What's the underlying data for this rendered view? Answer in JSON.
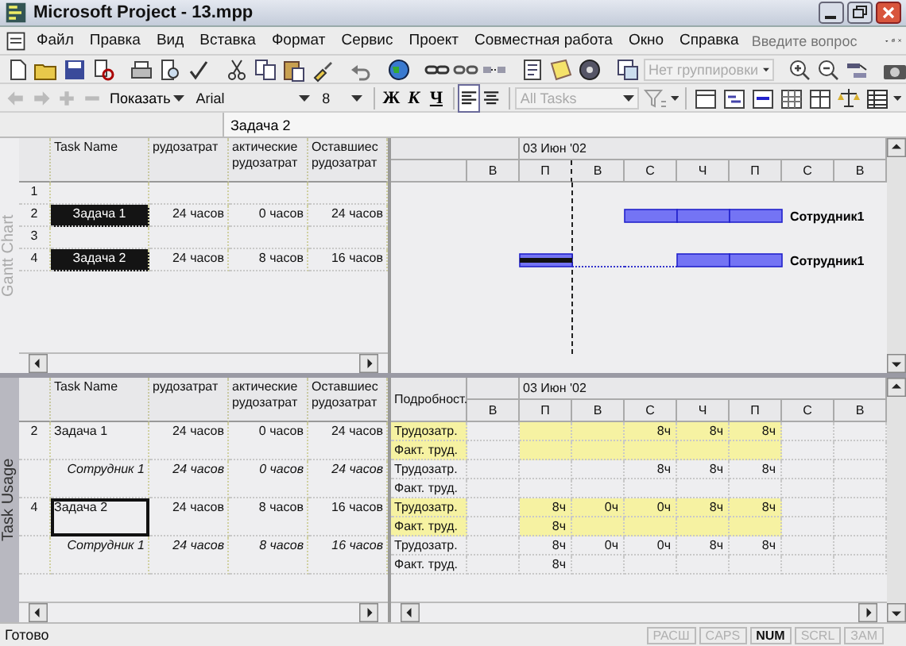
{
  "window": {
    "title": "Microsoft Project - 13.mpp"
  },
  "menu": {
    "items": [
      "Файл",
      "Правка",
      "Вид",
      "Вставка",
      "Формат",
      "Сервис",
      "Проект",
      "Совместная работа",
      "Окно",
      "Справка"
    ],
    "help_search": {
      "placeholder": "Введите вопрос"
    }
  },
  "toolbar": {
    "grouping": {
      "value": "Нет группировки",
      "disabled": true
    }
  },
  "formatting": {
    "show_button": "Показать",
    "font": "Arial",
    "size": "8",
    "styles": [
      {
        "kind": "bold",
        "label": "Ж"
      },
      {
        "kind": "italic",
        "label": "К"
      },
      {
        "kind": "underline",
        "label": "Ч"
      }
    ],
    "alignment": [
      {
        "kind": "left",
        "pressed": true
      },
      {
        "kind": "center",
        "pressed": false
      }
    ],
    "filter": {
      "value": "All Tasks",
      "disabled": true
    }
  },
  "entry_bar": {
    "value": "Задача 2"
  },
  "gantt": {
    "view_label": "Gantt Chart",
    "columns": [
      "Task Name",
      "рудозатрат",
      "актические рудозатрат",
      "Оставшиес рудозатрат"
    ],
    "rows": [
      {
        "num": "1",
        "highlighted": false
      },
      {
        "num": "2",
        "name": "Задача 1",
        "work": "24 часов",
        "actual": "0 часов",
        "remaining": "24 часов",
        "highlighted": true,
        "resource": "Сотрудник1",
        "schedule": [
          {
            "kind": "none"
          },
          {
            "kind": "none"
          },
          {
            "kind": "none"
          },
          {
            "kind": "work"
          },
          {
            "kind": "work"
          },
          {
            "kind": "work"
          },
          {
            "kind": "none"
          },
          {
            "kind": "none"
          }
        ]
      },
      {
        "num": "3",
        "highlighted": false
      },
      {
        "num": "4",
        "name": "Задача 2",
        "work": "24 часов",
        "actual": "8 часов",
        "remaining": "16 часов",
        "highlighted": true,
        "resource": "Сотрудник1",
        "level": 0.33,
        "schedule": [
          {
            "kind": "none"
          },
          {
            "kind": "work"
          },
          {
            "kind": "gap"
          },
          {
            "kind": "gap"
          },
          {
            "kind": "work"
          },
          {
            "kind": "work"
          },
          {
            "kind": "none"
          },
          {
            "kind": "none"
          }
        ]
      }
    ],
    "timescale": {
      "period": "03 Июн '02",
      "days": [
        {
          "label": "В",
          "status_date": false
        },
        {
          "label": "П",
          "status_date": true
        },
        {
          "label": "В",
          "status_date": false
        },
        {
          "label": "С",
          "status_date": false
        },
        {
          "label": "Ч",
          "status_date": false
        },
        {
          "label": "П",
          "status_date": false
        },
        {
          "label": "С",
          "status_date": false
        },
        {
          "label": "В",
          "status_date": false
        }
      ]
    }
  },
  "usage": {
    "view_label": "Task Usage",
    "columns": [
      "Task Name",
      "рудозатрат",
      "актические рудозатрат",
      "Оставшиес рудозатрат"
    ],
    "details_header": "Подробност.",
    "timescale": {
      "period": "03 Июн '02",
      "days": [
        {
          "label": "В",
          "nonworking": true
        },
        {
          "label": "П",
          "nonworking": false
        },
        {
          "label": "В",
          "nonworking": false
        },
        {
          "label": "С",
          "nonworking": false
        },
        {
          "label": "Ч",
          "nonworking": false
        },
        {
          "label": "П",
          "nonworking": false
        },
        {
          "label": "С",
          "nonworking": true
        },
        {
          "label": "В",
          "nonworking": true
        }
      ]
    },
    "rows": [
      {
        "kind": "task",
        "num": "2",
        "name": "Задача 1",
        "work": "24 часов",
        "actual": "0 часов",
        "remaining": "24 часов",
        "selected": false,
        "details": [
          {
            "label": "Трудозатр.",
            "cells": [
              {
                "kind": "blank"
              },
              {
                "kind": "blank"
              },
              {
                "kind": "blank"
              },
              {
                "kind": "hours",
                "value": "8ч"
              },
              {
                "kind": "hours",
                "value": "8ч"
              },
              {
                "kind": "hours",
                "value": "8ч"
              },
              {
                "kind": "blank"
              },
              {
                "kind": "blank"
              }
            ]
          },
          {
            "label": "Факт. труд."
          }
        ]
      },
      {
        "kind": "assignment",
        "name": "Сотрудник 1",
        "work": "24 часов",
        "actual": "0 часов",
        "remaining": "24 часов",
        "selected": false,
        "details": [
          {
            "label": "Трудозатр.",
            "cells": [
              {
                "kind": "blank"
              },
              {
                "kind": "blank"
              },
              {
                "kind": "blank"
              },
              {
                "kind": "hours",
                "value": "8ч"
              },
              {
                "kind": "hours",
                "value": "8ч"
              },
              {
                "kind": "hours",
                "value": "8ч"
              },
              {
                "kind": "blank"
              },
              {
                "kind": "blank"
              }
            ]
          },
          {
            "label": "Факт. труд."
          }
        ]
      },
      {
        "kind": "task",
        "num": "4",
        "name": "Задача 2",
        "work": "24 часов",
        "actual": "8 часов",
        "remaining": "16 часов",
        "selected": true,
        "details": [
          {
            "label": "Трудозатр.",
            "cells": [
              {
                "kind": "blank"
              },
              {
                "kind": "hours",
                "value": "8ч"
              },
              {
                "kind": "hours",
                "value": "0ч"
              },
              {
                "kind": "hours",
                "value": "0ч"
              },
              {
                "kind": "hours",
                "value": "8ч"
              },
              {
                "kind": "hours",
                "value": "8ч"
              },
              {
                "kind": "blank"
              },
              {
                "kind": "blank"
              }
            ]
          },
          {
            "label": "Факт. труд.",
            "cells": [
              {
                "kind": "blank"
              },
              {
                "kind": "hours",
                "value": "8ч"
              }
            ]
          }
        ]
      },
      {
        "kind": "assignment",
        "name": "Сотрудник 1",
        "work": "24 часов",
        "actual": "8 часов",
        "remaining": "16 часов",
        "selected": false,
        "details": [
          {
            "label": "Трудозатр.",
            "cells": [
              {
                "kind": "blank"
              },
              {
                "kind": "hours",
                "value": "8ч"
              },
              {
                "kind": "hours",
                "value": "0ч"
              },
              {
                "kind": "hours",
                "value": "0ч"
              },
              {
                "kind": "hours",
                "value": "8ч"
              },
              {
                "kind": "hours",
                "value": "8ч"
              },
              {
                "kind": "blank"
              },
              {
                "kind": "blank"
              }
            ]
          },
          {
            "label": "Факт. труд.",
            "cells": [
              {
                "kind": "blank"
              },
              {
                "kind": "hours",
                "value": "8ч"
              }
            ]
          }
        ]
      }
    ]
  },
  "status_bar": {
    "text": "Готово",
    "indicators": [
      {
        "label": "РАСШ",
        "on": false
      },
      {
        "label": "CAPS",
        "on": false
      },
      {
        "label": "NUM",
        "on": true
      },
      {
        "label": "SCRL",
        "on": false
      },
      {
        "label": "ЗАМ",
        "on": false
      }
    ]
  }
}
